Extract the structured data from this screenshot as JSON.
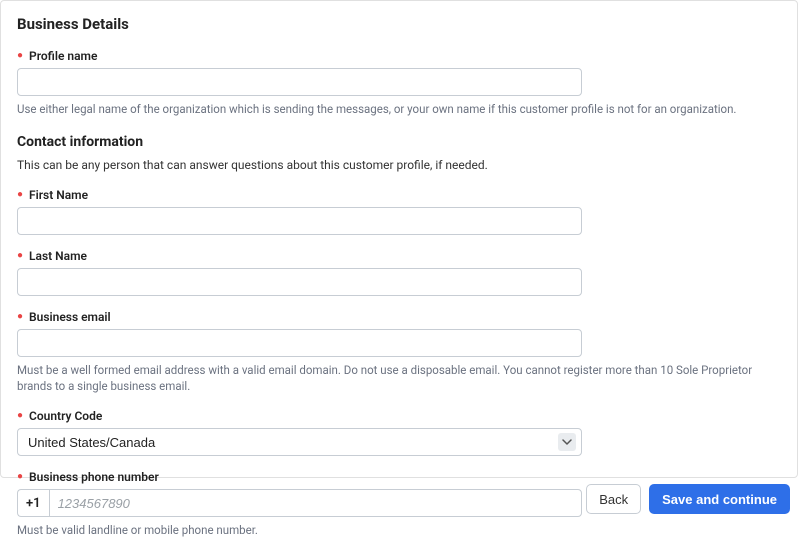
{
  "sections": {
    "business_details_title": "Business Details",
    "contact_info_title": "Contact information",
    "contact_info_desc": "This can be any person that can answer questions about this customer profile, if needed."
  },
  "fields": {
    "profile_name": {
      "label": "Profile name",
      "value": "",
      "help": "Use either legal name of the organization which is sending the messages, or your own name if this customer profile is not for an organization."
    },
    "first_name": {
      "label": "First Name",
      "value": ""
    },
    "last_name": {
      "label": "Last Name",
      "value": ""
    },
    "business_email": {
      "label": "Business email",
      "value": "",
      "help": "Must be a well formed email address with a valid email domain. Do not use a disposable email. You cannot register more than 10 Sole Proprietor brands to a single business email."
    },
    "country_code": {
      "label": "Country Code",
      "selected": "United States/Canada"
    },
    "business_phone": {
      "label": "Business phone number",
      "prefix": "+1",
      "placeholder": "1234567890",
      "value": "",
      "help": "Must be valid landline or mobile phone number."
    }
  },
  "buttons": {
    "back": "Back",
    "save": "Save and continue"
  }
}
